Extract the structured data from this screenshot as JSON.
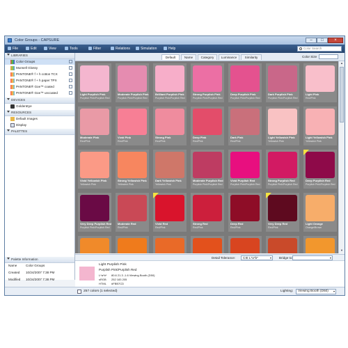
{
  "window": {
    "title": "Color Groups - CAPSURE"
  },
  "menu": {
    "items": [
      "File",
      "Edit",
      "View",
      "Tools",
      "Filter",
      "Relations",
      "Simulation",
      "Help"
    ]
  },
  "search": {
    "placeholder": "Color Search"
  },
  "left": {
    "libraries_header": "LIBRARIES",
    "libraries": [
      "Color Groups",
      "Munsell Glossy",
      "PANTONE® f + h cotton TCX",
      "PANTONE® f + h paper TPX",
      "PANTONE® Goe™ coated",
      "PANTONE® Goe™ uncoated"
    ],
    "devices_header": "DEVICES",
    "devices": [
      "GoldenEye"
    ],
    "resources_header": "RESOURCES",
    "resources": [
      "Default Images",
      "Display"
    ],
    "palettes_header": "PALETTES",
    "info_header": "Palette Information",
    "info": [
      {
        "key": "Name",
        "value": "Color Groups"
      },
      {
        "key": "Created",
        "value": "10/24/2007 7:38 PM"
      },
      {
        "key": "Modified",
        "value": "10/24/2007 7:38 PM"
      }
    ]
  },
  "tabs": [
    "Default",
    "Name",
    "Category",
    "Luminance",
    "Similarity"
  ],
  "color_size_label": "Color Size",
  "swatches": [
    {
      "name": "Light Purplish Pink",
      "sub": "Purplish Pink/Purplish Red",
      "color": "#f4b6cf",
      "flag": false
    },
    {
      "name": "Moderate Purplish Pink",
      "sub": "Purplish Pink/Purplish Red",
      "color": "#e58cb0",
      "flag": false
    },
    {
      "name": "Brilliant Purplish Pink",
      "sub": "Purplish Pink/Purplish Red",
      "color": "#f7aec9",
      "flag": false
    },
    {
      "name": "Strong Purplish Pink",
      "sub": "Purplish Pink/Purplish Red",
      "color": "#ec6fa4",
      "flag": false
    },
    {
      "name": "Deep Purplish Pink",
      "sub": "Purplish Pink/Purplish Red",
      "color": "#e4528f",
      "flag": false
    },
    {
      "name": "Dark Purplish Pink",
      "sub": "Purplish Pink/Purplish Red",
      "color": "#c96789",
      "flag": false
    },
    {
      "name": "Light Pink",
      "sub": "Red/Pink",
      "color": "#f9bfcb",
      "flag": false
    },
    {
      "name": "Moderate Pink",
      "sub": "Red/Pink",
      "color": "#e99aa6",
      "flag": false
    },
    {
      "name": "Vivid Pink",
      "sub": "Red/Pink",
      "color": "#f77f95",
      "flag": false
    },
    {
      "name": "Strong Pink",
      "sub": "Red/Pink",
      "color": "#ef8c9e",
      "flag": false
    },
    {
      "name": "Deep Pink",
      "sub": "Red/Pink",
      "color": "#e34d6a",
      "flag": false
    },
    {
      "name": "Dark Pink",
      "sub": "Red/Pink",
      "color": "#c9707b",
      "flag": false
    },
    {
      "name": "Light Yellowish Pink",
      "sub": "Yellowish Pink",
      "color": "#f9c2c3",
      "flag": false
    },
    {
      "name": "Light Yellowish Pink",
      "sub": "Yellowish Pink",
      "color": "#f8b1b4",
      "flag": false
    },
    {
      "name": "Vivid Yellowish Pink",
      "sub": "Yellowish Pink",
      "color": "#fb9a86",
      "flag": false
    },
    {
      "name": "Strong Yellowish Pink",
      "sub": "Yellowish Pink",
      "color": "#f7865f",
      "flag": false
    },
    {
      "name": "Dark Yellowish Pink",
      "sub": "Yellowish Pink",
      "color": "#cf7769",
      "flag": false
    },
    {
      "name": "Moderate Purplish Red",
      "sub": "Purplish Pink/Purplish Red",
      "color": "#be3c62",
      "flag": false
    },
    {
      "name": "Vivid Purplish Red",
      "sub": "Purplish Pink/Purplish Red",
      "color": "#e80f7f",
      "flag": false
    },
    {
      "name": "Strong Purplish Red",
      "sub": "Purplish Pink/Purplish Red",
      "color": "#d21a63",
      "flag": false
    },
    {
      "name": "Deep Purplish Red",
      "sub": "Purplish Pink/Purplish Red",
      "color": "#8e0a49",
      "flag": true
    },
    {
      "name": "Very Deep Purplish Red",
      "sub": "Purplish Pink/Purplish Red",
      "color": "#6a0a45",
      "flag": false
    },
    {
      "name": "Moderate Red",
      "sub": "Red/Pink",
      "color": "#c94956",
      "flag": false
    },
    {
      "name": "Vivid Red",
      "sub": "Red/Pink",
      "color": "#d9142c",
      "flag": true
    },
    {
      "name": "Strong Red",
      "sub": "Red/Pink",
      "color": "#cc1f3c",
      "flag": false
    },
    {
      "name": "Deep Red",
      "sub": "Red/Pink",
      "color": "#8e0d27",
      "flag": false
    },
    {
      "name": "Very Deep Red",
      "sub": "Red/Pink",
      "color": "#5e0a1f",
      "flag": true
    },
    {
      "name": "Light Orange",
      "sub": "Orange/Brown",
      "color": "#f7ad6a",
      "flag": false
    },
    {
      "name": "",
      "sub": "",
      "color": "#f08a2a",
      "flag": false
    },
    {
      "name": "",
      "sub": "",
      "color": "#ef7b1c",
      "flag": false
    },
    {
      "name": "",
      "sub": "",
      "color": "#e96a28",
      "flag": false
    },
    {
      "name": "",
      "sub": "",
      "color": "#e3511c",
      "flag": false
    },
    {
      "name": "",
      "sub": "",
      "color": "#d84520",
      "flag": false
    },
    {
      "name": "",
      "sub": "",
      "color": "#c94a2a",
      "flag": false
    },
    {
      "name": "",
      "sub": "",
      "color": "#f2972d",
      "flag": false
    }
  ],
  "detail": {
    "tolerance_label": "Detail Tolerance:",
    "tolerance_value": "CIE L*a*b*",
    "bridge_label": "Bridge to:"
  },
  "selected": {
    "name": "Light Purplish Pink",
    "sub": "Purplish Pink/Purplish Red",
    "color": "#f4b6cf",
    "rows": [
      {
        "key": "L*a*b*",
        "value": "80.6 21.3 -1.6 Viewing Booth (D50)"
      },
      {
        "key": "sRGB",
        "value": "252 183 205"
      },
      {
        "key": "HTML",
        "value": "#FBB7CD"
      }
    ]
  },
  "status": {
    "count": "257 colors (1 selected)",
    "lighting_label": "Lighting:",
    "lighting_value": "Viewing Booth (D50)"
  }
}
